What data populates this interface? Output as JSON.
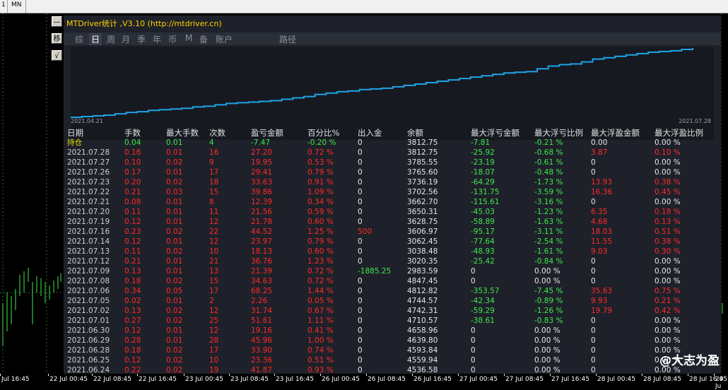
{
  "topbar": {
    "items": [
      "1",
      "MN"
    ]
  },
  "side_buttons": [
    "—",
    "移",
    "√"
  ],
  "panel": {
    "title": "MTDriver统计 ,V3.10 (http://mtdriver.cn)",
    "tabs": [
      "综",
      "日",
      "周",
      "月",
      "季",
      "年",
      "币",
      "M",
      "备",
      "账户",
      "路径"
    ],
    "active_tab": "日",
    "curve_start_label": "2021.04.21",
    "curve_end_label": "2021.07.28",
    "colors": {
      "curve": "#1fa3e6",
      "loss": "#ff2a2a",
      "gain": "#3fe84f",
      "title": "#ffd400"
    }
  },
  "chart_data": {
    "type": "line",
    "x_start": "2021.04.21",
    "x_end": "2021.07.28",
    "values": [
      0,
      1,
      2,
      3,
      5,
      7,
      8,
      10,
      11,
      12,
      13,
      15,
      16,
      18,
      20,
      21,
      22,
      23,
      24,
      26,
      28,
      30,
      33,
      35,
      37,
      38,
      40,
      41,
      42,
      44,
      46,
      48,
      50,
      52,
      54,
      56,
      58,
      60,
      62,
      64,
      65,
      66,
      70,
      74,
      76,
      77,
      80,
      84,
      86,
      88,
      90,
      92,
      94,
      95,
      96,
      98,
      100
    ]
  },
  "table": {
    "headers": [
      "日期",
      "手数",
      "最大手数",
      "次数",
      "盈亏金额",
      "百分比%",
      "出入金",
      "余额",
      "最大浮亏金额",
      "最大浮亏比例",
      "最大浮盈金额",
      "最大浮盈比例"
    ],
    "holding": [
      "持仓",
      "0.04",
      "0.01",
      "4",
      "-7.47",
      "-0.20 %",
      "0",
      "3812.75",
      "-7.81",
      "-0.21 %",
      "0.00",
      "0.00 %"
    ],
    "rows": [
      [
        "2021.07.28",
        "0.16",
        "0.01",
        "16",
        "27.20",
        "0.72 %",
        "0",
        "3812.75",
        "-25.92",
        "-0.68 %",
        "3.87",
        "0.10 %"
      ],
      [
        "2021.07.27",
        "0.10",
        "0.02",
        "9",
        "19.95",
        "0.53 %",
        "0",
        "3785.55",
        "-23.19",
        "-0.61 %",
        "0",
        "0.00 %"
      ],
      [
        "2021.07.26",
        "0.17",
        "0.01",
        "17",
        "29.41",
        "0.79 %",
        "0",
        "3765.60",
        "-18.07",
        "-0.48 %",
        "0",
        "0.00 %"
      ],
      [
        "2021.07.23",
        "0.20",
        "0.02",
        "18",
        "33.63",
        "0.91 %",
        "0",
        "3736.19",
        "-64.29",
        "-1.73 %",
        "13.93",
        "0.38 %"
      ],
      [
        "2021.07.22",
        "0.21",
        "0.03",
        "15",
        "39.86",
        "1.09 %",
        "0",
        "3702.56",
        "-131.75",
        "-3.59 %",
        "16.36",
        "0.45 %"
      ],
      [
        "2021.07.21",
        "0.08",
        "0.01",
        "8",
        "12.39",
        "0.34 %",
        "0",
        "3662.70",
        "-115.61",
        "-3.16 %",
        "0",
        "0.00 %"
      ],
      [
        "2021.07.20",
        "0.11",
        "0.01",
        "11",
        "21.56",
        "0.59 %",
        "0",
        "3650.31",
        "-45.03",
        "-1.23 %",
        "6.35",
        "0.18 %"
      ],
      [
        "2021.07.19",
        "0.12",
        "0.01",
        "12",
        "21.78",
        "0.60 %",
        "0",
        "3628.75",
        "-58.89",
        "-1.63 %",
        "4.68",
        "0.13 %"
      ],
      [
        "2021.07.16",
        "0.23",
        "0.02",
        "22",
        "44.52",
        "1.25 %",
        "500",
        "3606.97",
        "-95.17",
        "-3.11 %",
        "18.03",
        "0.51 %"
      ],
      [
        "2021.07.14",
        "0.12",
        "0.01",
        "12",
        "23.97",
        "0.79 %",
        "0",
        "3062.45",
        "-77.64",
        "-2.54 %",
        "11.55",
        "0.38 %"
      ],
      [
        "2021.07.13",
        "0.11",
        "0.02",
        "10",
        "18.13",
        "0.60 %",
        "0",
        "3038.48",
        "-48.93",
        "-1.61 %",
        "9.03",
        "0.30 %"
      ],
      [
        "2021.07.12",
        "0.21",
        "0.01",
        "21",
        "36.76",
        "1.23 %",
        "0",
        "3020.35",
        "-25.42",
        "-0.84 %",
        "0",
        "0.00 %"
      ],
      [
        "2021.07.09",
        "0.13",
        "0.01",
        "13",
        "21.39",
        "0.72 %",
        "-1885.25",
        "2983.59",
        "0",
        "0.00 %",
        "0",
        "0.00 %"
      ],
      [
        "2021.07.08",
        "0.18",
        "0.02",
        "15",
        "34.63",
        "0.72 %",
        "0",
        "4847.45",
        "0",
        "0.00 %",
        "0",
        "0.00 %"
      ],
      [
        "2021.07.06",
        "0.34",
        "0.05",
        "17",
        "68.25",
        "1.44 %",
        "0",
        "4812.82",
        "-353.57",
        "-7.45 %",
        "35.63",
        "0.75 %"
      ],
      [
        "2021.07.05",
        "0.02",
        "0.01",
        "2",
        "2.26",
        "0.05 %",
        "0",
        "4744.57",
        "-42.34",
        "-0.89 %",
        "9.93",
        "0.21 %"
      ],
      [
        "2021.07.02",
        "0.13",
        "0.02",
        "12",
        "31.74",
        "0.67 %",
        "0",
        "4742.31",
        "-59.29",
        "-1.26 %",
        "19.79",
        "0.42 %"
      ],
      [
        "2021.07.01",
        "0.27",
        "0.02",
        "25",
        "51.61",
        "1.11 %",
        "0",
        "4710.57",
        "-38.61",
        "-0.83 %",
        "0",
        "0.00 %"
      ],
      [
        "2021.06.30",
        "0.12",
        "0.01",
        "12",
        "19.16",
        "0.41 %",
        "0",
        "4658.96",
        "0",
        "0.00 %",
        "0",
        "0.00 %"
      ],
      [
        "2021.06.29",
        "0.28",
        "0.01",
        "28",
        "45.96",
        "1.00 %",
        "0",
        "4639.80",
        "0",
        "0.00 %",
        "0",
        "0.00 %"
      ],
      [
        "2021.06.28",
        "0.18",
        "0.02",
        "17",
        "33.90",
        "0.74 %",
        "0",
        "4593.84",
        "0",
        "0.00 %",
        "0",
        "0.00 %"
      ],
      [
        "2021.06.25",
        "0.12",
        "0.02",
        "10",
        "23.36",
        "0.51 %",
        "0",
        "4559.94",
        "0",
        "0.00 %",
        "0",
        "0.00 %"
      ],
      [
        "2021.06.24",
        "0.22",
        "0.02",
        "19",
        "41.87",
        "0.93 %",
        "0",
        "4536.58",
        "0",
        "0.00 %",
        "0",
        "0.00 %"
      ]
    ]
  },
  "time_axis": [
    "Jul 16:45",
    "22 Jul 00:45",
    "22 Jul 08:45",
    "22 Jul 16:45",
    "23 Jul 00:45",
    "23 Jul 08:45",
    "23 Jul 16:45",
    "26 Jul 00:45",
    "26 Jul 08:45",
    "26 Jul 16:45",
    "27 Jul 00:45",
    "27 Jul 08:45",
    "27 Jul 16:45",
    "28 Jul 00:45",
    "28 Jul 08:45",
    "28 Jul 16:45",
    "29 Ju"
  ],
  "watermark": "@大志为盈"
}
